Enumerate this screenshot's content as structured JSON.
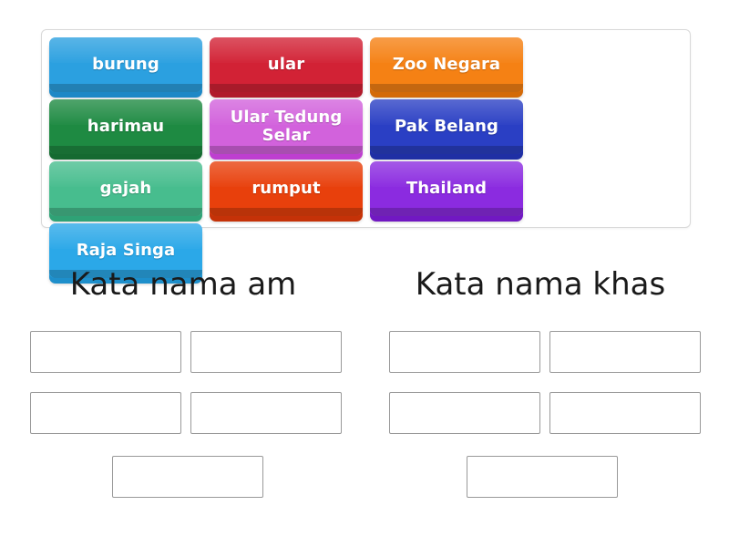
{
  "activity": {
    "type": "group-sort",
    "tray": {
      "tiles": [
        {
          "label": "burung",
          "color": "#2BA0E0",
          "shade": "#1E88C6"
        },
        {
          "label": "ular",
          "color": "#D22235",
          "shade": "#B01A2B"
        },
        {
          "label": "Zoo Negara",
          "color": "#F58114",
          "shade": "#D36A08"
        },
        {
          "label": "harimau",
          "color": "#1E8A42",
          "shade": "#156A31"
        },
        {
          "label": "Ular Tedung Selar",
          "color": "#D262DC",
          "shade": "#BE3FD0"
        },
        {
          "label": "Pak Belang",
          "color": "#2A3FC4",
          "shade": "#1F2FA4"
        },
        {
          "label": "gajah",
          "color": "#47BD8E",
          "shade": "#2FA276"
        },
        {
          "label": "rumput",
          "color": "#E8400C",
          "shade": "#C53208"
        },
        {
          "label": "Thailand",
          "color": "#8B2BE0",
          "shade": "#7118C2"
        },
        {
          "label": "Raja Singa",
          "color": "#2BA8E8",
          "shade": "#1E8FCB"
        }
      ]
    },
    "columns": [
      {
        "heading": "Kata nama am",
        "dropzones": [
          {
            "value": ""
          },
          {
            "value": ""
          },
          {
            "value": ""
          },
          {
            "value": ""
          },
          {
            "value": ""
          }
        ]
      },
      {
        "heading": "Kata nama khas",
        "dropzones": [
          {
            "value": ""
          },
          {
            "value": ""
          },
          {
            "value": ""
          },
          {
            "value": ""
          },
          {
            "value": ""
          }
        ]
      }
    ]
  }
}
